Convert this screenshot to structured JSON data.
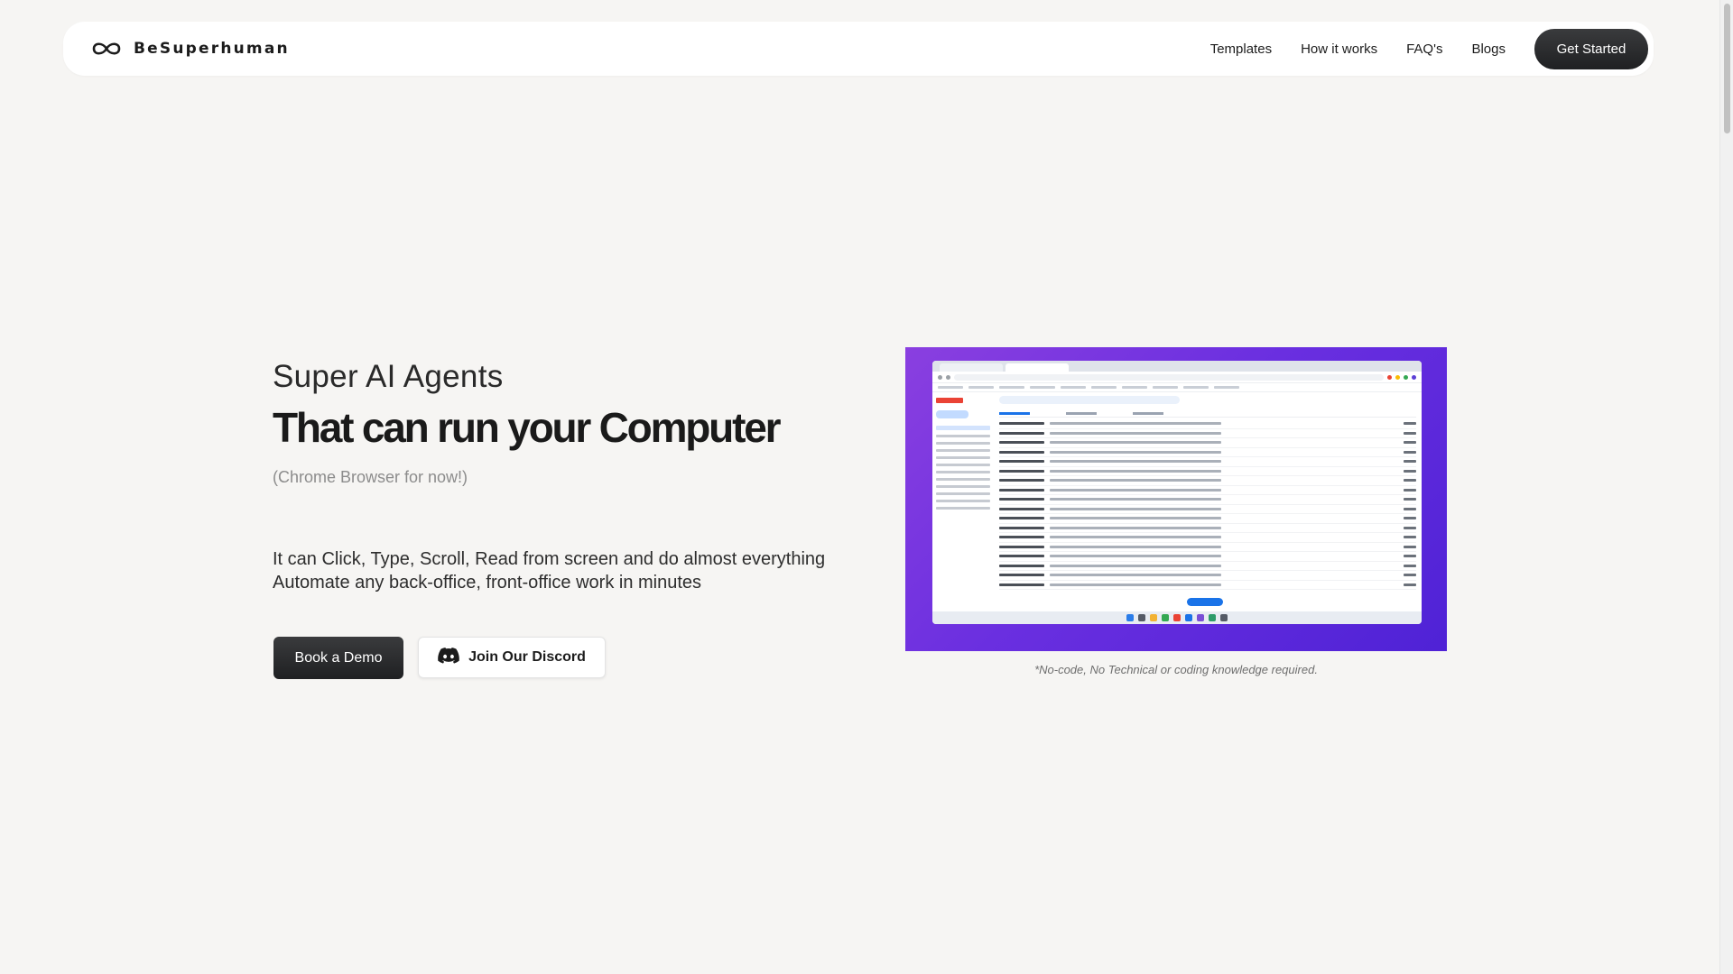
{
  "navbar": {
    "brand_name": "BeSuperhuman",
    "links": [
      "Templates",
      "How it works",
      "FAQ's",
      "Blogs"
    ],
    "cta_label": "Get Started"
  },
  "hero": {
    "eyebrow": "Super AI Agents",
    "title": "That can run your Computer",
    "note": "(Chrome Browser for now!)",
    "description_line1": "It can Click, Type, Scroll, Read from screen and do almost everything",
    "description_line2": "Automate any back-office, front-office work in minutes",
    "primary_button": "Book a Demo",
    "secondary_button": "Join Our Discord",
    "media_caption": "*No-code, No  Technical  or coding knowledge required."
  },
  "icons": {
    "brand_logo": "infinity-icon",
    "discord": "discord-icon"
  },
  "colors": {
    "background": "#f6f5f3",
    "dark_button": "#262729",
    "media_gradient_start": "#8a3fe0",
    "media_gradient_end": "#4f22d6"
  }
}
